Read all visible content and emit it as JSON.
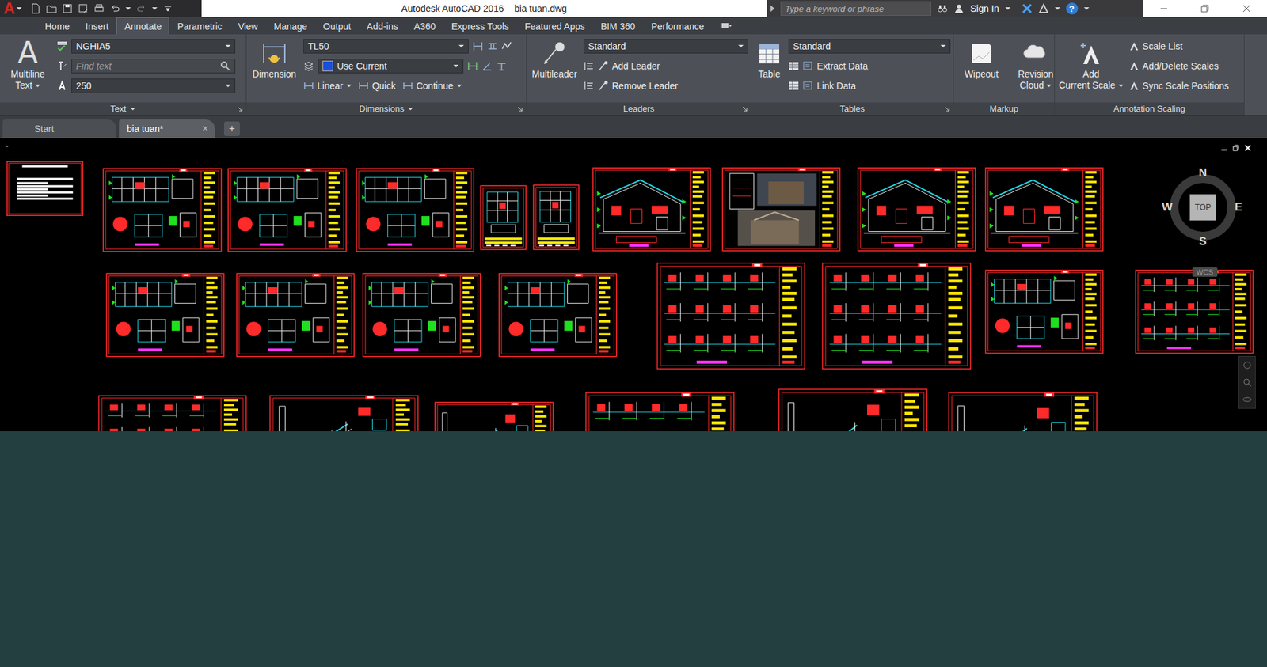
{
  "window": {
    "app": "Autodesk AutoCAD 2016",
    "file": "bia tuan.dwg"
  },
  "app_logo": "A",
  "search": {
    "placeholder": "Type a keyword or phrase"
  },
  "account": {
    "label": "Sign In"
  },
  "help": "?",
  "ribbon_tabs": [
    {
      "label": "Home",
      "selected": false
    },
    {
      "label": "Insert",
      "selected": false
    },
    {
      "label": "Annotate",
      "selected": true
    },
    {
      "label": "Parametric",
      "selected": false
    },
    {
      "label": "View",
      "selected": false
    },
    {
      "label": "Manage",
      "selected": false
    },
    {
      "label": "Output",
      "selected": false
    },
    {
      "label": "Add-ins",
      "selected": false
    },
    {
      "label": "A360",
      "selected": false
    },
    {
      "label": "Express Tools",
      "selected": false
    },
    {
      "label": "Featured Apps",
      "selected": false
    },
    {
      "label": "BIM 360",
      "selected": false
    },
    {
      "label": "Performance",
      "selected": false
    }
  ],
  "ribbon": {
    "text": {
      "label": "Text",
      "menu": true,
      "launcher": true,
      "big": {
        "glyph": "A",
        "label": [
          "Multiline",
          "Text"
        ],
        "menu": true
      },
      "style": "NGHIA5",
      "find": "Find text",
      "height": "250"
    },
    "dimensions": {
      "label": "Dimensions",
      "menu": true,
      "launcher": true,
      "big": {
        "label": [
          "Dimension"
        ],
        "menu": false
      },
      "style": "TL50",
      "layer": "Use Current",
      "layer_color": "#1c4fd8",
      "tools": [
        {
          "label": "Linear",
          "menu": true
        },
        {
          "label": "Quick",
          "menu": false
        },
        {
          "label": "Continue",
          "menu": true
        }
      ]
    },
    "leaders": {
      "label": "Leaders",
      "menu": false,
      "launcher": true,
      "big": {
        "label": [
          "Multileader"
        ],
        "menu": false
      },
      "style": "Standard",
      "tools": [
        "Add Leader",
        "Remove Leader"
      ]
    },
    "tables": {
      "label": "Tables",
      "menu": false,
      "launcher": true,
      "big": {
        "label": [
          "Table"
        ],
        "menu": false
      },
      "style": "Standard",
      "tools": [
        "Extract Data",
        "Link Data"
      ]
    },
    "markup": {
      "label": "Markup",
      "menu": false,
      "launcher": false,
      "tools": [
        {
          "label": [
            "Wipeout"
          ],
          "menu": false
        },
        {
          "label": [
            "Revision",
            "Cloud"
          ],
          "menu": true
        }
      ]
    },
    "scaling": {
      "label": "Annotation Scaling",
      "menu": false,
      "launcher": false,
      "big": {
        "label": [
          "Add",
          "Current Scale"
        ],
        "menu": true
      },
      "tools": [
        "Scale List",
        "Add/Delete Scales",
        "Sync Scale Positions"
      ]
    }
  },
  "file_tabs": [
    {
      "label": "Start",
      "selected": false,
      "closable": false
    },
    {
      "label": "bia tuan*",
      "selected": true,
      "closable": true
    }
  ],
  "tab_close": "×",
  "new_tab": "+",
  "viewport": {
    "menu": "-"
  },
  "viewcube": {
    "north": "N",
    "south": "S",
    "east": "E",
    "west": "W",
    "face": "TOP",
    "ucs": "WCS"
  },
  "sheets": [
    {
      "kind": "cover"
    },
    {
      "kind": "plan"
    },
    {
      "kind": "plan"
    },
    {
      "kind": "plan"
    },
    {
      "kind": "detail"
    },
    {
      "kind": "detail"
    },
    {
      "kind": "elevation"
    },
    {
      "kind": "photo"
    },
    {
      "kind": "elevation"
    },
    {
      "kind": "elevation"
    },
    {
      "kind": "plan"
    },
    {
      "kind": "plan"
    },
    {
      "kind": "plan"
    },
    {
      "kind": "plan"
    },
    {
      "kind": "section"
    },
    {
      "kind": "section"
    },
    {
      "kind": "plan"
    },
    {
      "kind": "section"
    },
    {
      "kind": "section"
    },
    {
      "kind": "stair"
    },
    {
      "kind": "stair"
    },
    {
      "kind": "section"
    },
    {
      "kind": "stair"
    },
    {
      "kind": "stair"
    }
  ]
}
